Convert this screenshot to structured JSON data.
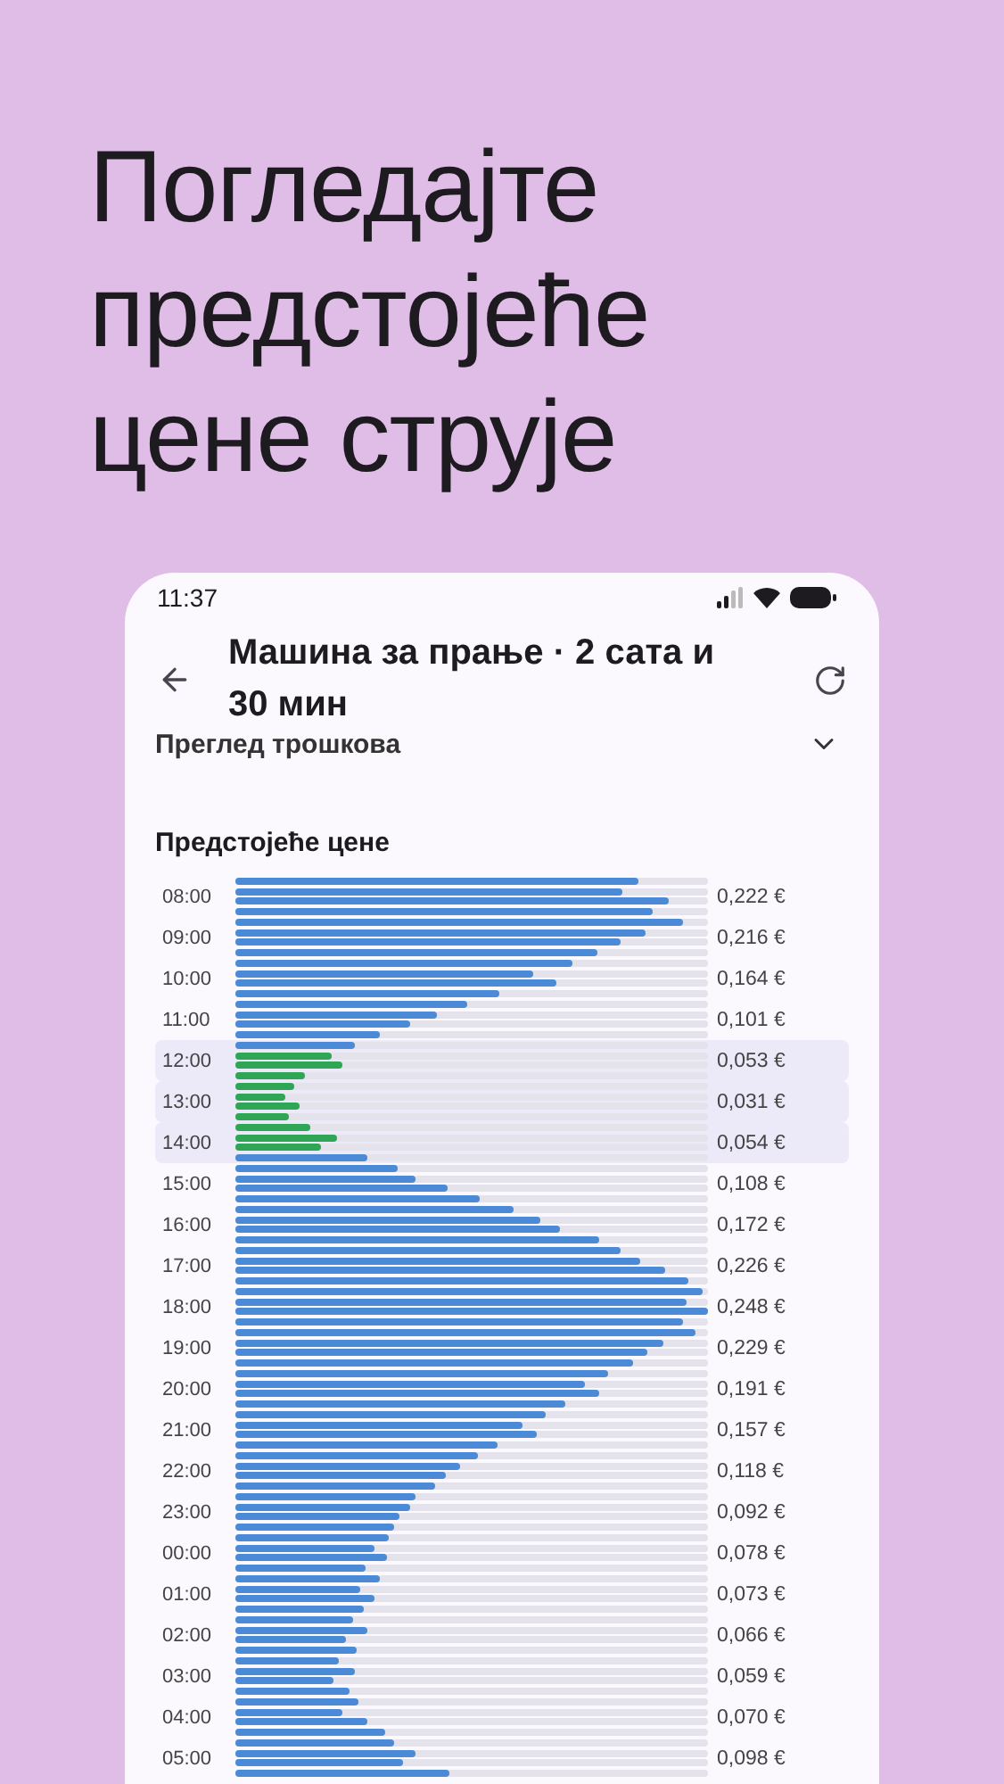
{
  "headline": "Погледајте предстојеће цене струје",
  "status_bar": {
    "time": "11:37"
  },
  "header": {
    "title": "Машина за прање · 2 сата и 30 мин"
  },
  "section": {
    "title": "Преглед трошкова",
    "expanded": false
  },
  "prices": {
    "title": "Предстојеће цене",
    "hours": [
      {
        "time": "08:00",
        "price": "0,222 €",
        "highlighted": false,
        "bars": [
          {
            "level": 0.854,
            "in_run": false
          },
          {
            "level": 0.82,
            "in_run": false
          },
          {
            "level": 0.918,
            "in_run": false
          },
          {
            "level": 0.883,
            "in_run": false
          }
        ]
      },
      {
        "time": "09:00",
        "price": "0,216 €",
        "highlighted": false,
        "bars": [
          {
            "level": 0.946,
            "in_run": false
          },
          {
            "level": 0.867,
            "in_run": false
          },
          {
            "level": 0.815,
            "in_run": false
          },
          {
            "level": 0.765,
            "in_run": false
          }
        ]
      },
      {
        "time": "10:00",
        "price": "0,164 €",
        "highlighted": false,
        "bars": [
          {
            "level": 0.712,
            "in_run": false
          },
          {
            "level": 0.631,
            "in_run": false
          },
          {
            "level": 0.678,
            "in_run": false
          },
          {
            "level": 0.557,
            "in_run": false
          }
        ]
      },
      {
        "time": "11:00",
        "price": "0,101 €",
        "highlighted": false,
        "bars": [
          {
            "level": 0.489,
            "in_run": false
          },
          {
            "level": 0.427,
            "in_run": false
          },
          {
            "level": 0.368,
            "in_run": false
          },
          {
            "level": 0.305,
            "in_run": false
          }
        ]
      },
      {
        "time": "12:00",
        "price": "0,053 €",
        "highlighted": true,
        "bars": [
          {
            "level": 0.253,
            "in_run": false
          },
          {
            "level": 0.204,
            "in_run": true
          },
          {
            "level": 0.227,
            "in_run": true
          },
          {
            "level": 0.148,
            "in_run": true
          }
        ]
      },
      {
        "time": "13:00",
        "price": "0,031 €",
        "highlighted": true,
        "bars": [
          {
            "level": 0.124,
            "in_run": true
          },
          {
            "level": 0.104,
            "in_run": true
          },
          {
            "level": 0.136,
            "in_run": true
          },
          {
            "level": 0.112,
            "in_run": true
          }
        ]
      },
      {
        "time": "14:00",
        "price": "0,054 €",
        "highlighted": true,
        "bars": [
          {
            "level": 0.16,
            "in_run": true
          },
          {
            "level": 0.215,
            "in_run": true
          },
          {
            "level": 0.182,
            "in_run": true
          },
          {
            "level": 0.281,
            "in_run": false
          }
        ]
      },
      {
        "time": "15:00",
        "price": "0,108 €",
        "highlighted": false,
        "bars": [
          {
            "level": 0.344,
            "in_run": false
          },
          {
            "level": 0.382,
            "in_run": false
          },
          {
            "level": 0.45,
            "in_run": false
          },
          {
            "level": 0.518,
            "in_run": false
          }
        ]
      },
      {
        "time": "16:00",
        "price": "0,172 €",
        "highlighted": false,
        "bars": [
          {
            "level": 0.59,
            "in_run": false
          },
          {
            "level": 0.646,
            "in_run": false
          },
          {
            "level": 0.686,
            "in_run": false
          },
          {
            "level": 0.768,
            "in_run": false
          }
        ]
      },
      {
        "time": "17:00",
        "price": "0,226 €",
        "highlighted": false,
        "bars": [
          {
            "level": 0.815,
            "in_run": false
          },
          {
            "level": 0.858,
            "in_run": false
          },
          {
            "level": 0.91,
            "in_run": false
          },
          {
            "level": 0.957,
            "in_run": false
          }
        ]
      },
      {
        "time": "18:00",
        "price": "0,248 €",
        "highlighted": false,
        "bars": [
          {
            "level": 0.987,
            "in_run": false
          },
          {
            "level": 0.953,
            "in_run": false
          },
          {
            "level": 1.0,
            "in_run": false
          },
          {
            "level": 0.946,
            "in_run": false
          }
        ]
      },
      {
        "time": "19:00",
        "price": "0,229 €",
        "highlighted": false,
        "bars": [
          {
            "level": 0.972,
            "in_run": false
          },
          {
            "level": 0.906,
            "in_run": false
          },
          {
            "level": 0.871,
            "in_run": false
          },
          {
            "level": 0.843,
            "in_run": false
          }
        ]
      },
      {
        "time": "20:00",
        "price": "0,191 €",
        "highlighted": false,
        "bars": [
          {
            "level": 0.789,
            "in_run": false
          },
          {
            "level": 0.74,
            "in_run": false
          },
          {
            "level": 0.771,
            "in_run": false
          },
          {
            "level": 0.698,
            "in_run": false
          }
        ]
      },
      {
        "time": "21:00",
        "price": "0,157 €",
        "highlighted": false,
        "bars": [
          {
            "level": 0.658,
            "in_run": false
          },
          {
            "level": 0.607,
            "in_run": false
          },
          {
            "level": 0.638,
            "in_run": false
          },
          {
            "level": 0.553,
            "in_run": false
          }
        ]
      },
      {
        "time": "22:00",
        "price": "0,118 €",
        "highlighted": false,
        "bars": [
          {
            "level": 0.513,
            "in_run": false
          },
          {
            "level": 0.474,
            "in_run": false
          },
          {
            "level": 0.446,
            "in_run": false
          },
          {
            "level": 0.422,
            "in_run": false
          }
        ]
      },
      {
        "time": "23:00",
        "price": "0,092 €",
        "highlighted": false,
        "bars": [
          {
            "level": 0.383,
            "in_run": false
          },
          {
            "level": 0.368,
            "in_run": false
          },
          {
            "level": 0.347,
            "in_run": false
          },
          {
            "level": 0.335,
            "in_run": false
          }
        ]
      },
      {
        "time": "00:00",
        "price": "0,078 €",
        "highlighted": false,
        "bars": [
          {
            "level": 0.323,
            "in_run": false
          },
          {
            "level": 0.296,
            "in_run": false
          },
          {
            "level": 0.32,
            "in_run": false
          },
          {
            "level": 0.276,
            "in_run": false
          }
        ]
      },
      {
        "time": "01:00",
        "price": "0,073 €",
        "highlighted": false,
        "bars": [
          {
            "level": 0.304,
            "in_run": false
          },
          {
            "level": 0.265,
            "in_run": false
          },
          {
            "level": 0.293,
            "in_run": false
          },
          {
            "level": 0.273,
            "in_run": false
          }
        ]
      },
      {
        "time": "02:00",
        "price": "0,066 €",
        "highlighted": false,
        "bars": [
          {
            "level": 0.25,
            "in_run": false
          },
          {
            "level": 0.28,
            "in_run": false
          },
          {
            "level": 0.234,
            "in_run": false
          },
          {
            "level": 0.256,
            "in_run": false
          }
        ]
      },
      {
        "time": "03:00",
        "price": "0,059 €",
        "highlighted": false,
        "bars": [
          {
            "level": 0.217,
            "in_run": false
          },
          {
            "level": 0.253,
            "in_run": false
          },
          {
            "level": 0.206,
            "in_run": false
          },
          {
            "level": 0.241,
            "in_run": false
          }
        ]
      },
      {
        "time": "04:00",
        "price": "0,070 €",
        "highlighted": false,
        "bars": [
          {
            "level": 0.261,
            "in_run": false
          },
          {
            "level": 0.227,
            "in_run": false
          },
          {
            "level": 0.28,
            "in_run": false
          },
          {
            "level": 0.317,
            "in_run": false
          }
        ]
      },
      {
        "time": "05:00",
        "price": "0,098 €",
        "highlighted": false,
        "bars": [
          {
            "level": 0.335,
            "in_run": false
          },
          {
            "level": 0.382,
            "in_run": false
          },
          {
            "level": 0.356,
            "in_run": false
          },
          {
            "level": 0.451,
            "in_run": false
          }
        ]
      }
    ]
  }
}
